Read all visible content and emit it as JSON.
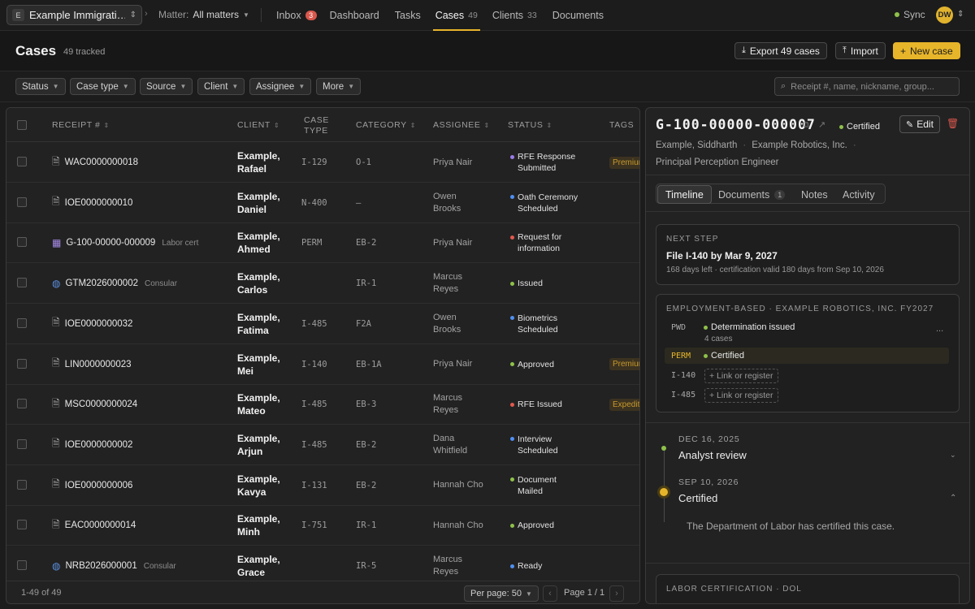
{
  "topbar": {
    "workspace_initial": "E",
    "workspace_name": "Example Immigrati…",
    "matter_label": "Matter:",
    "matter_value": "All matters",
    "nav": [
      {
        "label": "Inbox",
        "badge": "3"
      },
      {
        "label": "Dashboard"
      },
      {
        "label": "Tasks"
      },
      {
        "label": "Cases",
        "count": "49"
      },
      {
        "label": "Clients",
        "count": "33"
      },
      {
        "label": "Documents"
      }
    ],
    "sync_label": "Sync",
    "avatar_initials": "DW"
  },
  "header": {
    "title": "Cases",
    "tracked": "49 tracked",
    "export_label": "Export 49 cases",
    "import_label": "Import",
    "new_label": "New case"
  },
  "filters": {
    "buttons": [
      "Status",
      "Case type",
      "Source",
      "Client",
      "Assignee",
      "More"
    ],
    "search_placeholder": "Receipt #, name, nickname, group..."
  },
  "table": {
    "columns": {
      "receipt": "RECEIPT #",
      "client": "CLIENT",
      "case_type_1": "CASE",
      "case_type_2": "TYPE",
      "category": "CATEGORY",
      "assignee": "ASSIGNEE",
      "status": "STATUS",
      "tags": "TAGS"
    },
    "rows": [
      {
        "receipt": "WAC0000000018",
        "sub": "",
        "icon": "doc",
        "client1": "Example,",
        "client2": "Rafael",
        "case_type": "I-129",
        "category": "O-1",
        "assignee1": "Priya Nair",
        "assignee2": "",
        "status1": "RFE Response",
        "status2": "Submitted",
        "status_color": "#9b7be8",
        "tag": "Premium"
      },
      {
        "receipt": "IOE0000000010",
        "sub": "",
        "icon": "doc",
        "client1": "Example,",
        "client2": "Daniel",
        "case_type": "N-400",
        "category": "—",
        "assignee1": "Owen",
        "assignee2": "Brooks",
        "status1": "Oath Ceremony",
        "status2": "Scheduled",
        "status_color": "#4f8ff0",
        "tag": ""
      },
      {
        "receipt": "G-100-00000-000009",
        "sub": "Labor cert",
        "icon": "building",
        "client1": "Example,",
        "client2": "Ahmed",
        "case_type": "PERM",
        "category": "EB-2",
        "assignee1": "Priya Nair",
        "assignee2": "",
        "status1": "Request for",
        "status2": "information",
        "status_color": "#e0594f",
        "tag": ""
      },
      {
        "receipt": "GTM2026000002",
        "sub": "Consular",
        "icon": "globe",
        "client1": "Example,",
        "client2": "Carlos",
        "case_type": "",
        "category": "IR-1",
        "assignee1": "Marcus",
        "assignee2": "Reyes",
        "status1": "Issued",
        "status2": "",
        "status_color": "#8fc14a",
        "tag": ""
      },
      {
        "receipt": "IOE0000000032",
        "sub": "",
        "icon": "doc",
        "client1": "Example,",
        "client2": "Fatima",
        "case_type": "I-485",
        "category": "F2A",
        "assignee1": "Owen",
        "assignee2": "Brooks",
        "status1": "Biometrics",
        "status2": "Scheduled",
        "status_color": "#4f8ff0",
        "tag": ""
      },
      {
        "receipt": "LIN0000000023",
        "sub": "",
        "icon": "doc",
        "client1": "Example,",
        "client2": "Mei",
        "case_type": "I-140",
        "category": "EB-1A",
        "assignee1": "Priya Nair",
        "assignee2": "",
        "status1": "Approved",
        "status2": "",
        "status_color": "#8fc14a",
        "tag": "Premium"
      },
      {
        "receipt": "MSC0000000024",
        "sub": "",
        "icon": "doc",
        "client1": "Example,",
        "client2": "Mateo",
        "case_type": "I-485",
        "category": "EB-3",
        "assignee1": "Marcus",
        "assignee2": "Reyes",
        "status1": "RFE Issued",
        "status2": "",
        "status_color": "#e0594f",
        "tag": "Expedite"
      },
      {
        "receipt": "IOE0000000002",
        "sub": "",
        "icon": "doc",
        "client1": "Example,",
        "client2": "Arjun",
        "case_type": "I-485",
        "category": "EB-2",
        "assignee1": "Dana",
        "assignee2": "Whitfield",
        "status1": "Interview",
        "status2": "Scheduled",
        "status_color": "#4f8ff0",
        "tag": ""
      },
      {
        "receipt": "IOE0000000006",
        "sub": "",
        "icon": "doc",
        "client1": "Example,",
        "client2": "Kavya",
        "case_type": "I-131",
        "category": "EB-2",
        "assignee1": "Hannah Cho",
        "assignee2": "",
        "status1": "Document",
        "status2": "Mailed",
        "status_color": "#8fc14a",
        "tag": ""
      },
      {
        "receipt": "EAC0000000014",
        "sub": "",
        "icon": "doc",
        "client1": "Example,",
        "client2": "Minh",
        "case_type": "I-751",
        "category": "IR-1",
        "assignee1": "Hannah Cho",
        "assignee2": "",
        "status1": "Approved",
        "status2": "",
        "status_color": "#8fc14a",
        "tag": ""
      },
      {
        "receipt": "NRB2026000001",
        "sub": "Consular",
        "icon": "globe",
        "client1": "Example,",
        "client2": "Grace",
        "case_type": "",
        "category": "IR-5",
        "assignee1": "Marcus",
        "assignee2": "Reyes",
        "status1": "Ready",
        "status2": "",
        "status_color": "#4f8ff0",
        "tag": ""
      }
    ],
    "footer": {
      "range": "1-49 of 49",
      "per_page": "Per page: 50",
      "page": "Page 1 / 1"
    }
  },
  "detail": {
    "receipt": "G-100-00000-000007",
    "status": "Certified",
    "edit_label": "Edit",
    "client": "Example, Siddharth",
    "employer": "Example Robotics, Inc.",
    "job_title": "Principal Perception Engineer",
    "tabs": [
      {
        "label": "Timeline"
      },
      {
        "label": "Documents",
        "badge": "1"
      },
      {
        "label": "Notes"
      },
      {
        "label": "Activity"
      }
    ],
    "next_step": {
      "heading": "NEXT STEP",
      "title": "File I-140 by Mar 9, 2027",
      "sub": "168 days left · certification valid 180 days from Sep 10, 2026"
    },
    "group": {
      "heading": "EMPLOYMENT-BASED · EXAMPLE ROBOTICS, INC. FY2027",
      "steps": [
        {
          "code": "PWD",
          "label": "Determination issued",
          "sub": "4 cases"
        },
        {
          "code": "PERM",
          "label": "Certified"
        },
        {
          "code": "I-140",
          "link": "+ Link or register"
        },
        {
          "code": "I-485",
          "link": "+ Link or register"
        }
      ],
      "more": "..."
    },
    "timeline": [
      {
        "date": "DEC 16, 2025",
        "title": "Analyst review"
      },
      {
        "date": "SEP 10, 2026",
        "title": "Certified",
        "body": "The Department of Labor has certified this case."
      }
    ],
    "labor_heading": "LABOR CERTIFICATION · DOL",
    "colors": {
      "accent": "#e7b52a",
      "green": "#8fc14a"
    }
  }
}
